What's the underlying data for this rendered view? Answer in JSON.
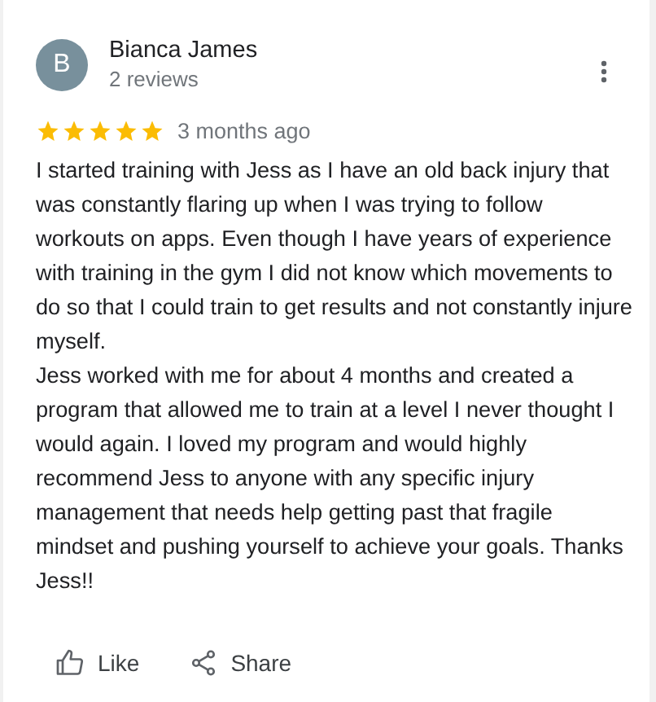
{
  "review": {
    "avatar_letter": "B",
    "author": "Bianca James",
    "review_count": "2 reviews",
    "stars": 5,
    "time": "3 months ago",
    "paragraphs": [
      "I started training with Jess as I have an old back injury that was constantly flaring up when I was trying to follow workouts on apps. Even though I have years of experience with training in the gym I did not know which movements to do so that I could train to get results and not constantly injure myself.",
      "Jess worked with me for about 4 months and created a program that allowed me to train at a level I never thought I would again. I loved my program and would highly recommend Jess to anyone with any specific injury management that needs help getting past that fragile mindset and pushing yourself to achieve your goals. Thanks Jess!!"
    ]
  },
  "actions": [
    {
      "kind": "like",
      "label": "Like"
    },
    {
      "kind": "share",
      "label": "Share"
    }
  ]
}
